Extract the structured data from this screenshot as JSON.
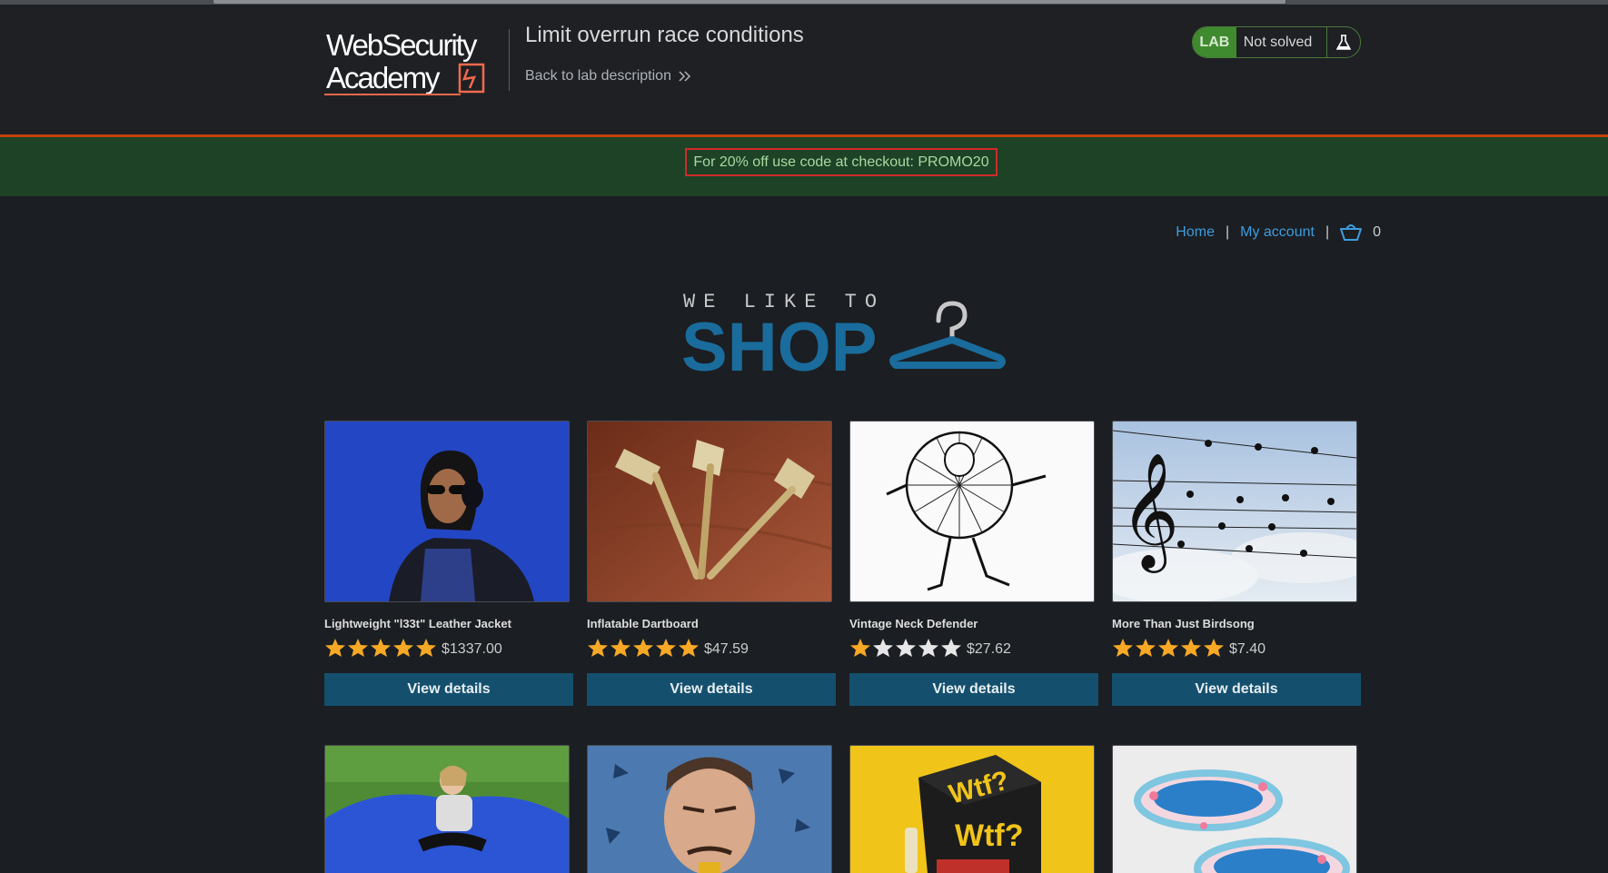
{
  "header": {
    "logo_line1": "WebSecurity",
    "logo_line2": "Academy",
    "lab_title": "Limit overrun race conditions",
    "back_link": "Back to lab description",
    "lab_badge": "LAB",
    "status": "Not solved",
    "colors": {
      "badge": "#3f8a2e",
      "accent_line": "#c2410c"
    }
  },
  "promo": {
    "text": "For 20% off use code at checkout: PROMO20"
  },
  "nav": {
    "home": "Home",
    "separator": "|",
    "my_account": "My account",
    "cart_count": "0",
    "cart_icon": "basket-icon"
  },
  "banner": {
    "line1": "WE LIKE TO",
    "line2": "SHOP"
  },
  "products": [
    {
      "name": "Lightweight \"l33t\" Leather Jacket",
      "rating": 5,
      "price": "$1337.00",
      "button": "View details",
      "image": "woman-headphones"
    },
    {
      "name": "Inflatable Dartboard",
      "rating": 5,
      "price": "$47.59",
      "button": "View details",
      "image": "darts"
    },
    {
      "name": "Vintage Neck Defender",
      "rating": 1,
      "price": "$27.62",
      "button": "View details",
      "image": "neck-ruff-drawing"
    },
    {
      "name": "More Than Just Birdsong",
      "rating": 5,
      "price": "$7.40",
      "button": "View details",
      "image": "music-notes-birds"
    },
    {
      "image": "girl-bean-bag"
    },
    {
      "image": "man-grimace"
    },
    {
      "image": "wtf-game-box"
    },
    {
      "image": "paddling-pools"
    }
  ]
}
